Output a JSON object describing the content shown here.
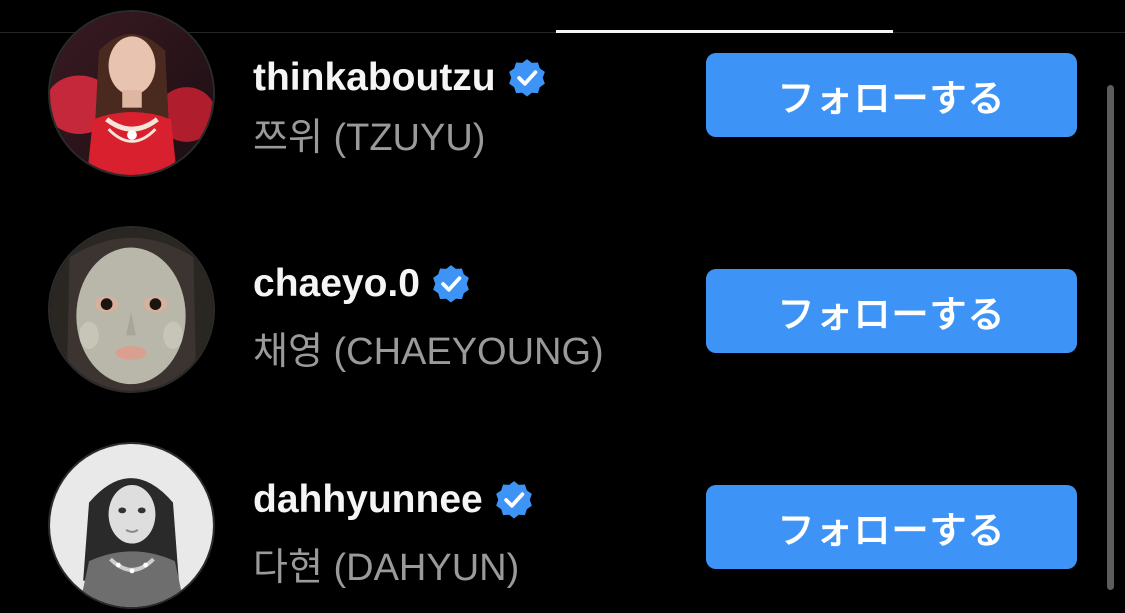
{
  "colors": {
    "accent": "#3d94f6",
    "verified": "#3d94f6",
    "background": "#000000"
  },
  "accounts": [
    {
      "username": "thinkaboutzu",
      "display_name": "쯔위 (TZUYU)",
      "verified": true,
      "follow_label": "フォローする",
      "avatar": "profile-photo"
    },
    {
      "username": "chaeyo.0",
      "display_name": "채영 (CHAEYOUNG)",
      "verified": true,
      "follow_label": "フォローする",
      "avatar": "profile-photo"
    },
    {
      "username": "dahhyunnee",
      "display_name": "다현 (DAHYUN)",
      "verified": true,
      "follow_label": "フォローする",
      "avatar": "profile-photo"
    }
  ],
  "icons": {
    "verified": "verified-badge-icon"
  }
}
